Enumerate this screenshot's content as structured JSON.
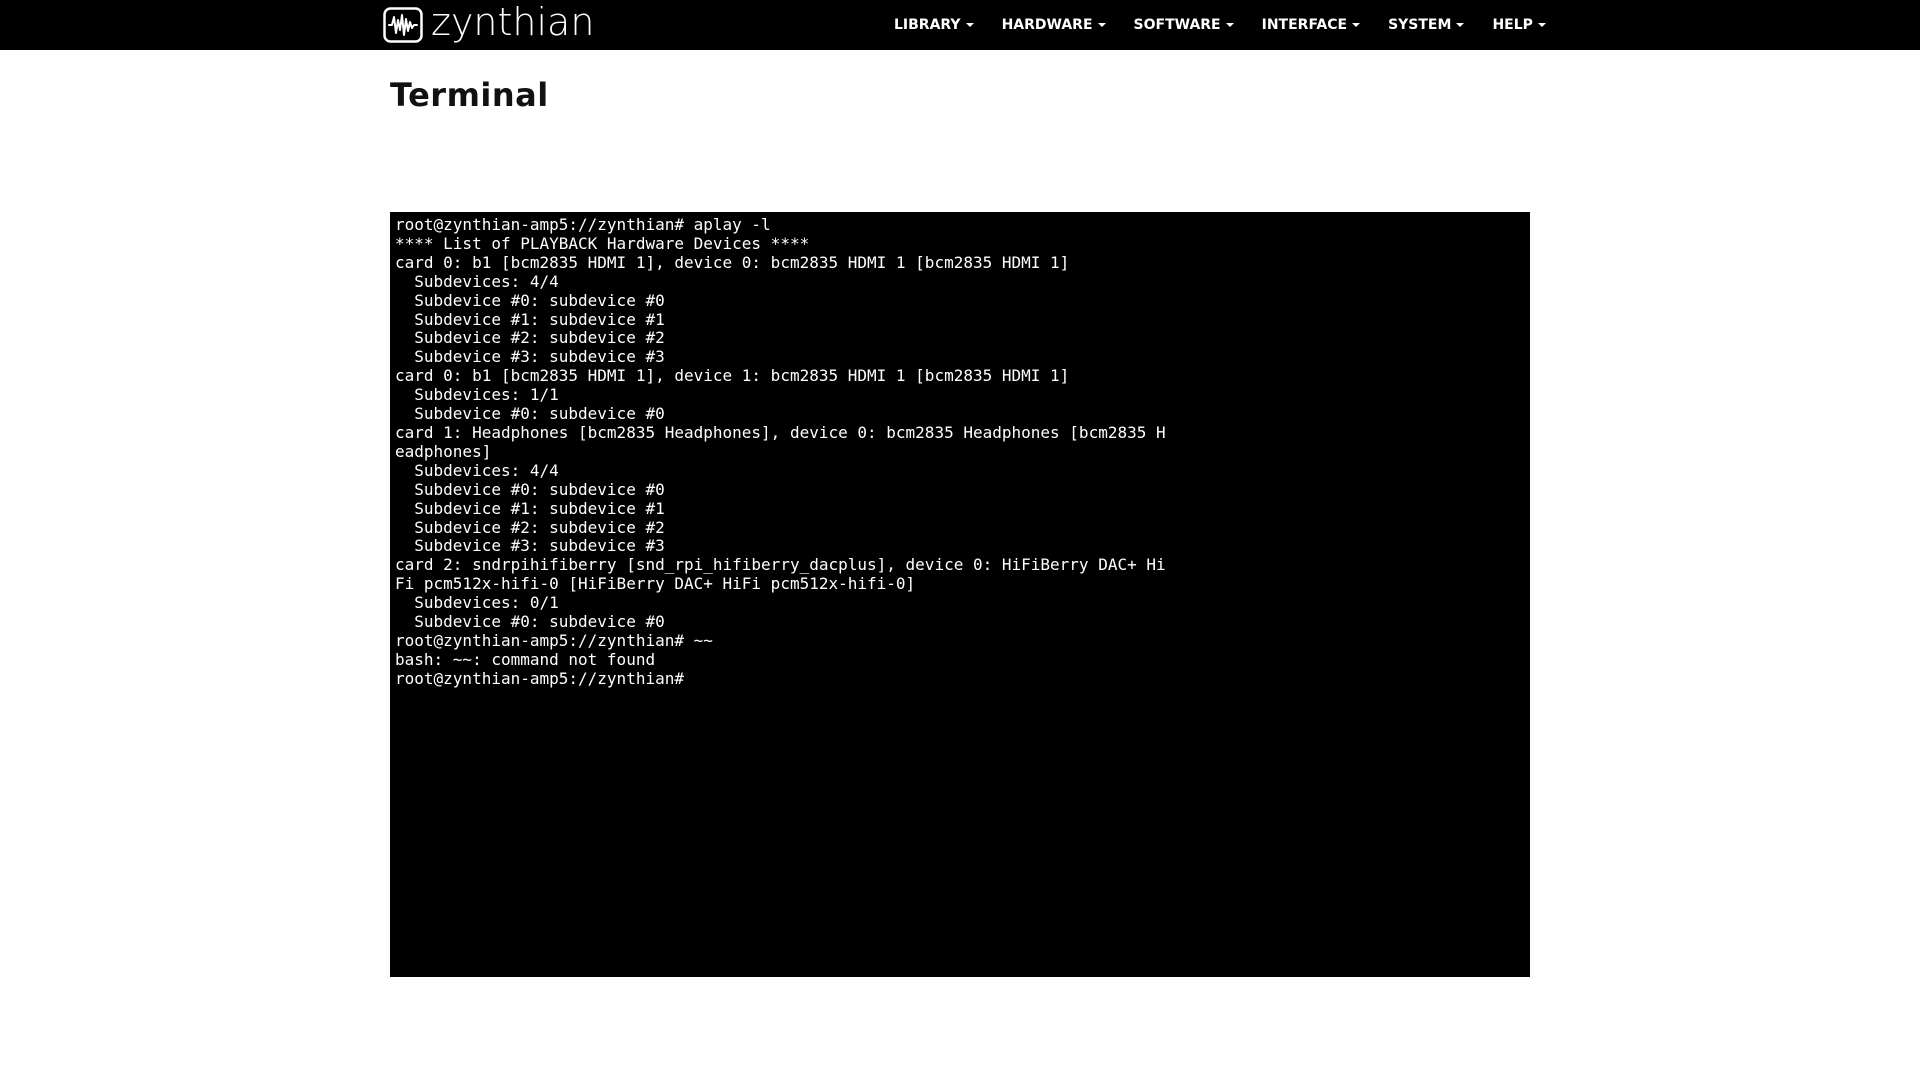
{
  "brand": {
    "name": "zynthian",
    "logo_icon": "waveform-logo-icon"
  },
  "nav": {
    "items": [
      {
        "label": "LIBRARY"
      },
      {
        "label": "HARDWARE"
      },
      {
        "label": "SOFTWARE"
      },
      {
        "label": "INTERFACE"
      },
      {
        "label": "SYSTEM"
      },
      {
        "label": "HELP"
      }
    ]
  },
  "page": {
    "title": "Terminal"
  },
  "terminal": {
    "lines": [
      "root@zynthian-amp5://zynthian# aplay -l",
      "**** List of PLAYBACK Hardware Devices ****",
      "card 0: b1 [bcm2835 HDMI 1], device 0: bcm2835 HDMI 1 [bcm2835 HDMI 1]",
      "  Subdevices: 4/4",
      "  Subdevice #0: subdevice #0",
      "  Subdevice #1: subdevice #1",
      "  Subdevice #2: subdevice #2",
      "  Subdevice #3: subdevice #3",
      "card 0: b1 [bcm2835 HDMI 1], device 1: bcm2835 HDMI 1 [bcm2835 HDMI 1]",
      "  Subdevices: 1/1",
      "  Subdevice #0: subdevice #0",
      "card 1: Headphones [bcm2835 Headphones], device 0: bcm2835 Headphones [bcm2835 H",
      "eadphones]",
      "  Subdevices: 4/4",
      "  Subdevice #0: subdevice #0",
      "  Subdevice #1: subdevice #1",
      "  Subdevice #2: subdevice #2",
      "  Subdevice #3: subdevice #3",
      "card 2: sndrpihifiberry [snd_rpi_hifiberry_dacplus], device 0: HiFiBerry DAC+ Hi",
      "Fi pcm512x-hifi-0 [HiFiBerry DAC+ HiFi pcm512x-hifi-0]",
      "  Subdevices: 0/1",
      "  Subdevice #0: subdevice #0",
      "root@zynthian-amp5://zynthian# ~~",
      "bash: ~~: command not found",
      "root@zynthian-amp5://zynthian#"
    ]
  },
  "colors": {
    "navbar_bg": "#000000",
    "nav_text": "#ffffff",
    "terminal_bg": "#000000",
    "terminal_text": "#ffffff",
    "page_bg": "#ffffff"
  }
}
